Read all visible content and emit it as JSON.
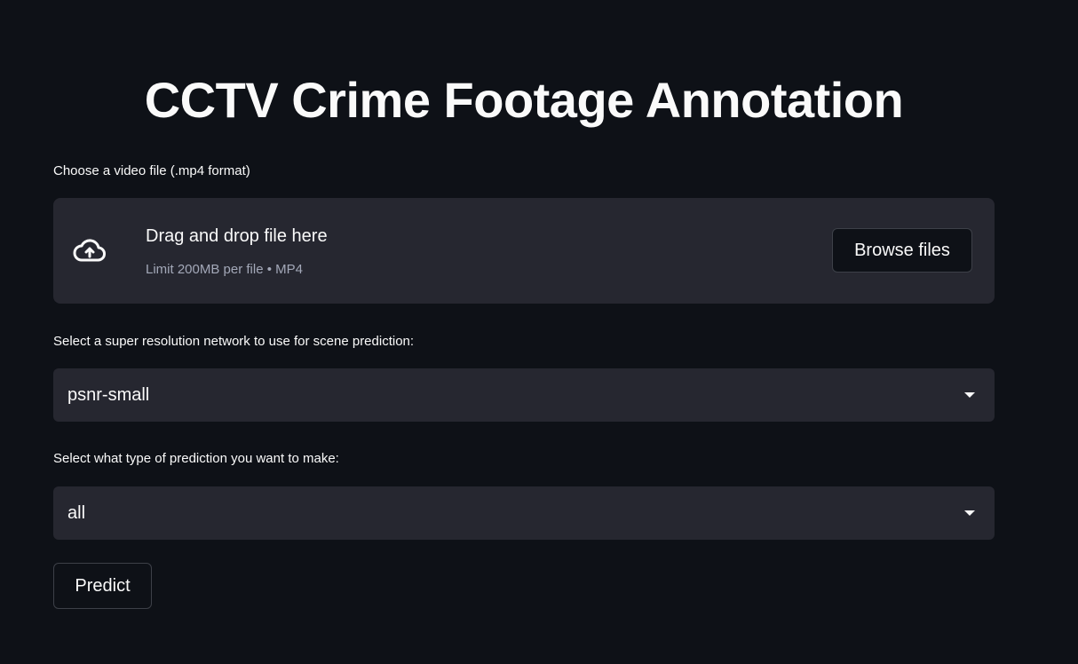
{
  "header": {
    "title": "CCTV Crime Footage Annotation"
  },
  "uploader": {
    "label": "Choose a video file (.mp4 format)",
    "drop_text": "Drag and drop file here",
    "limit_text": "Limit 200MB per file • MP4",
    "browse_label": "Browse files",
    "icon": "cloud-upload-icon"
  },
  "network_select": {
    "label": "Select a super resolution network to use for scene prediction:",
    "value": "psnr-small",
    "icon": "chevron-down-icon"
  },
  "prediction_select": {
    "label": "Select what type of prediction you want to make:",
    "value": "all",
    "icon": "chevron-down-icon"
  },
  "actions": {
    "predict_label": "Predict"
  },
  "colors": {
    "background": "#0e1117",
    "panel": "#262730",
    "text": "#fafafa",
    "muted_text": "#a3a8b8",
    "border": "#3d4048"
  }
}
